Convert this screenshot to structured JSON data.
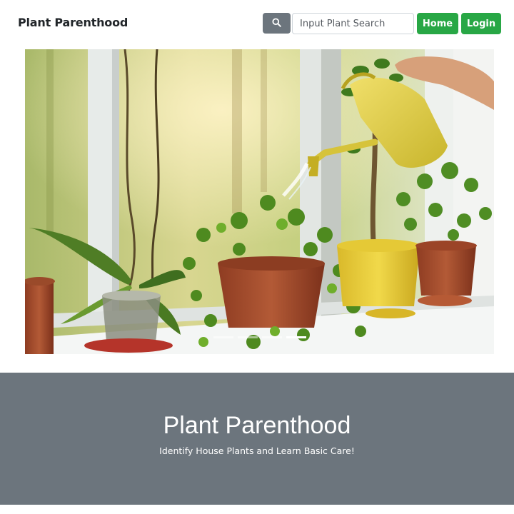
{
  "navbar": {
    "brand": "Plant Parenthood",
    "search": {
      "placeholder": "Input Plant Search",
      "value": "",
      "icon": "search-icon"
    },
    "home_label": "Home",
    "login_label": "Login"
  },
  "carousel": {
    "slide_count": 4,
    "active_index": 3
  },
  "hero": {
    "title": "Plant Parenthood",
    "subtitle": "Identify House Plants and Learn Basic Care!"
  },
  "colors": {
    "accent_green": "#28a745",
    "secondary_gray": "#6c757d"
  }
}
